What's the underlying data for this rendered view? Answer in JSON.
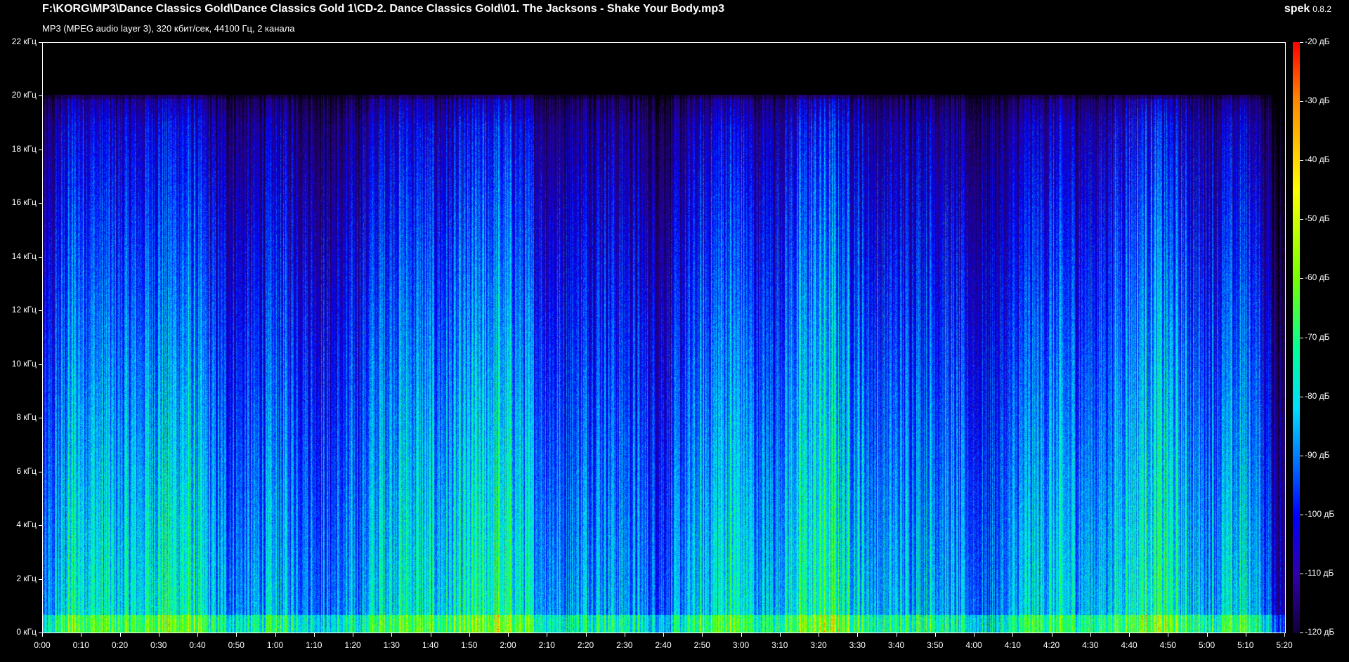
{
  "window": {
    "file_path": "F:\\KORG\\MP3\\Dance Classics Gold\\Dance Classics Gold 1\\CD-2. Dance Classics Gold\\01. The Jacksons - Shake Your Body.mp3",
    "file_info": "MP3 (MPEG audio layer 3), 320 кбит/сек, 44100 Гц, 2 канала",
    "app_name": "spek",
    "app_version": "0.8.2"
  },
  "y_axis": {
    "ticks": [
      {
        "label": "22 кГц",
        "value": 22
      },
      {
        "label": "20 кГц",
        "value": 20
      },
      {
        "label": "18 кГц",
        "value": 18
      },
      {
        "label": "16 кГц",
        "value": 16
      },
      {
        "label": "14 кГц",
        "value": 14
      },
      {
        "label": "12 кГц",
        "value": 12
      },
      {
        "label": "10 кГц",
        "value": 10
      },
      {
        "label": "8 кГц",
        "value": 8
      },
      {
        "label": "6 кГц",
        "value": 6
      },
      {
        "label": "4 кГц",
        "value": 4
      },
      {
        "label": "2 кГц",
        "value": 2
      },
      {
        "label": "0 кГц",
        "value": 0
      }
    ]
  },
  "x_axis": {
    "ticks": [
      "0:00",
      "0:10",
      "0:20",
      "0:30",
      "0:40",
      "0:50",
      "1:00",
      "1:10",
      "1:20",
      "1:30",
      "1:40",
      "1:50",
      "2:00",
      "2:10",
      "2:20",
      "2:30",
      "2:40",
      "2:50",
      "3:00",
      "3:10",
      "3:20",
      "3:30",
      "3:40",
      "3:50",
      "4:00",
      "4:10",
      "4:20",
      "4:30",
      "4:40",
      "4:50",
      "5:00",
      "5:10",
      "5:20"
    ]
  },
  "legend": {
    "ticks": [
      "-20 дБ",
      "-30 дБ",
      "-40 дБ",
      "-50 дБ",
      "-60 дБ",
      "-70 дБ",
      "-80 дБ",
      "-90 дБ",
      "-100 дБ",
      "-110 дБ",
      "-120 дБ"
    ],
    "colors": [
      "#ff0000",
      "#ff8800",
      "#ffff00",
      "#77ff00",
      "#00ff99",
      "#00ddff",
      "#0066ff",
      "#0000ff",
      "#3000aa",
      "#10003a"
    ]
  }
}
